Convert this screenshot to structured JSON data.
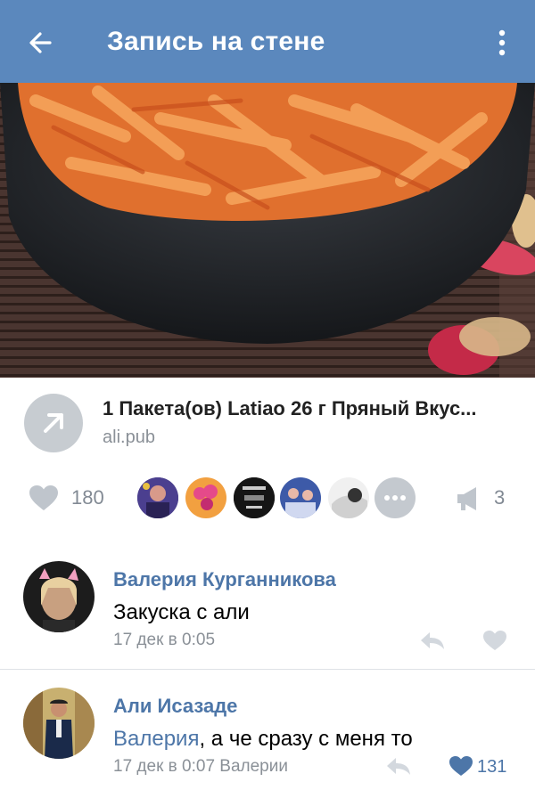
{
  "header": {
    "title": "Запись на стене",
    "back_icon": "arrow-left-icon",
    "menu_icon": "more-vertical-icon",
    "color": "#5b88bd"
  },
  "post": {
    "link": {
      "title": "1 Пакета(ов) Latiao 26 г Пряный Вкус...",
      "domain": "ali.pub",
      "icon": "share-arrow-icon"
    },
    "likes": {
      "count": "180"
    },
    "reposts": {
      "count": "3"
    }
  },
  "comments": [
    {
      "author": "Валерия Курганникова",
      "text": "Закуска с али",
      "meta": "17 дек в 0:05",
      "likes": ""
    },
    {
      "author": "Али Исазаде",
      "mention": "Валерия",
      "text": ", а че сразу с меня то",
      "meta": "17 дек в 0:07 Валерии",
      "likes": "131"
    }
  ]
}
